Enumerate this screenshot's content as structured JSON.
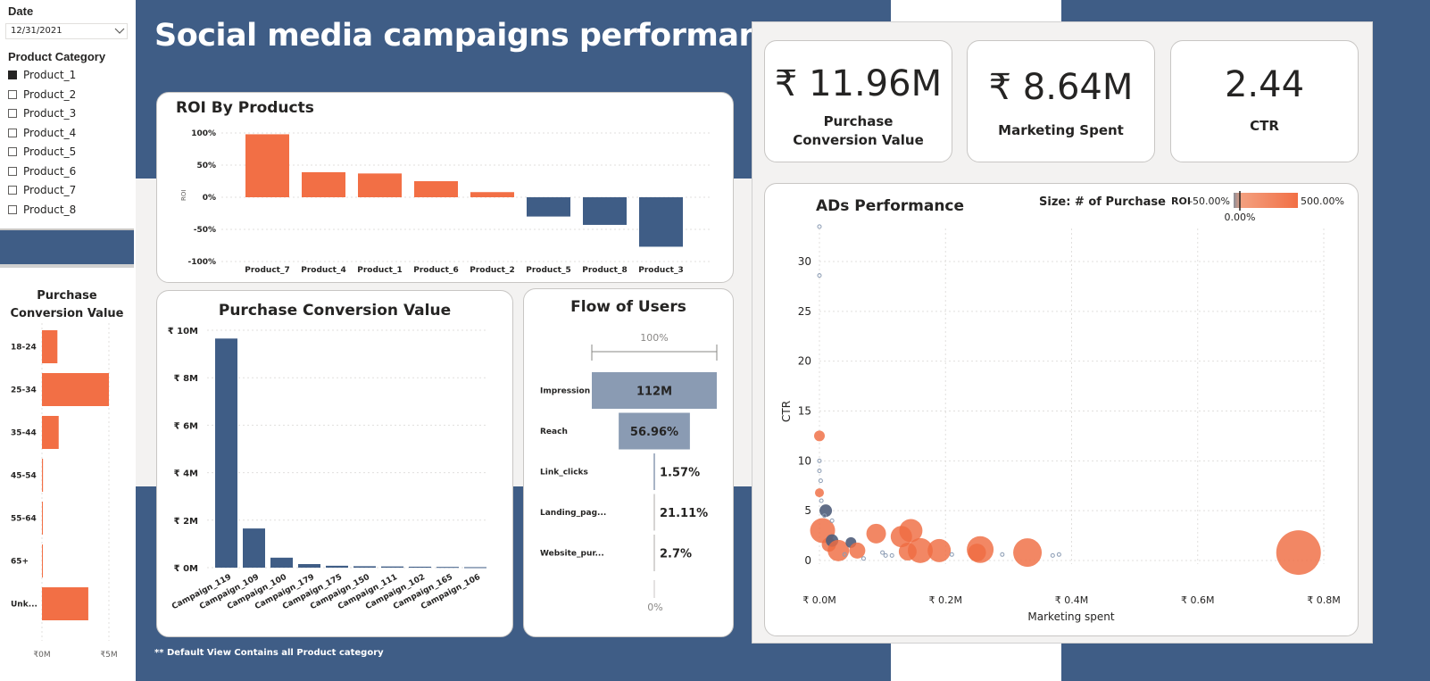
{
  "filters": {
    "date_label": "Date",
    "date_value": "12/31/2021",
    "category_label": "Product Category",
    "products": [
      {
        "label": "Product_1",
        "checked": true
      },
      {
        "label": "Product_2",
        "checked": false
      },
      {
        "label": "Product_3",
        "checked": false
      },
      {
        "label": "Product_4",
        "checked": false
      },
      {
        "label": "Product_5",
        "checked": false
      },
      {
        "label": "Product_6",
        "checked": false
      },
      {
        "label": "Product_7",
        "checked": false
      },
      {
        "label": "Product_8",
        "checked": false
      }
    ]
  },
  "title": "Social media campaigns performance",
  "footnote": "** Default View Contains all Product category",
  "kpis": [
    {
      "value": "₹ 11.96M",
      "label": "Purchase Conversion Value"
    },
    {
      "value": "₹ 8.64M",
      "label": "Marketing Spent"
    },
    {
      "value": "2.44",
      "label": "CTR"
    }
  ],
  "colors": {
    "navy": "#3f5d86",
    "orange": "#f26f45",
    "funnel": "#8a9bb3",
    "background_light": "#f3f2f1"
  },
  "chart_data": [
    {
      "type": "bar",
      "title": "Purchase Conversion Value",
      "orientation": "horizontal",
      "categories": [
        "18-24",
        "25-34",
        "35-44",
        "45-54",
        "55-64",
        "65+",
        "Unk..."
      ],
      "values": [
        1.2,
        5.2,
        1.3,
        0.08,
        0.05,
        0.05,
        3.6
      ],
      "value_unit": "₹ M",
      "xticks": [
        "₹0M",
        "₹5M"
      ],
      "xlim": [
        0,
        5.2
      ]
    },
    {
      "type": "bar",
      "title": "ROI By Products",
      "ylabel": "ROI",
      "categories": [
        "Product_7",
        "Product_4",
        "Product_1",
        "Product_6",
        "Product_2",
        "Product_5",
        "Product_8",
        "Product_3"
      ],
      "values": [
        98,
        39,
        37,
        25,
        8,
        -30,
        -43,
        -77
      ],
      "value_unit": "%",
      "yticks": [
        "100%",
        "50%",
        "0%",
        "-50%",
        "-100%"
      ],
      "ylim": [
        -100,
        100
      ]
    },
    {
      "type": "bar",
      "title": "Purchase Conversion Value",
      "categories": [
        "Campaign_119",
        "Campaign_109",
        "Campaign_100",
        "Campaign_179",
        "Campaign_175",
        "Campaign_150",
        "Campaign_111",
        "Campaign_102",
        "Campaign_165",
        "Campaign_106"
      ],
      "values": [
        9.65,
        1.65,
        0.42,
        0.15,
        0.08,
        0.06,
        0.05,
        0.04,
        0.03,
        0.02
      ],
      "value_unit": "₹ M",
      "yticks": [
        "₹ 10M",
        "₹ 8M",
        "₹ 6M",
        "₹ 4M",
        "₹ 2M",
        "₹ 0M"
      ],
      "ylim": [
        0,
        10
      ]
    },
    {
      "type": "funnel",
      "title": "Flow of Users",
      "top_label": "100%",
      "bottom_label": "0%",
      "stages": [
        {
          "label": "Impression",
          "value_label": "112M",
          "fraction": 1.0
        },
        {
          "label": "Reach",
          "value_label": "56.96%",
          "fraction": 0.5696
        },
        {
          "label": "Link_clicks",
          "value_label": "1.57%",
          "fraction": 0.0157
        },
        {
          "label": "Landing_pag...",
          "value_label": "21.11%",
          "fraction": 0.0
        },
        {
          "label": "Website_pur...",
          "value_label": "2.7%",
          "fraction": 0.0
        }
      ]
    },
    {
      "type": "scatter",
      "title": "ADs Performance",
      "size_legend": "Size: # of Purchase",
      "color_legend": {
        "label": "ROI",
        "min_label": "-50.00%",
        "mid_label": "0.00%",
        "max_label": "500.00%"
      },
      "xlabel": "Marketing spent",
      "ylabel": "CTR",
      "xticks": [
        "₹ 0.0M",
        "₹ 0.2M",
        "₹ 0.4M",
        "₹ 0.6M",
        "₹ 0.8M"
      ],
      "yticks": [
        "30",
        "25",
        "20",
        "15",
        "10",
        "5",
        "0"
      ],
      "xlim": [
        0,
        0.8
      ],
      "ylim": [
        0,
        30
      ],
      "points": [
        {
          "x": 0.0,
          "y": 12.5,
          "r": 6,
          "kind": "orange"
        },
        {
          "x": 0.0,
          "y": 6.8,
          "r": 5,
          "kind": "orange"
        },
        {
          "x": 0.01,
          "y": 5.0,
          "r": 7,
          "kind": "dark"
        },
        {
          "x": 0.005,
          "y": 3.0,
          "r": 14,
          "kind": "orange"
        },
        {
          "x": 0.015,
          "y": 1.6,
          "r": 8,
          "kind": "orange"
        },
        {
          "x": 0.02,
          "y": 2.0,
          "r": 7,
          "kind": "dark"
        },
        {
          "x": 0.03,
          "y": 1.0,
          "r": 12,
          "kind": "orange"
        },
        {
          "x": 0.05,
          "y": 1.8,
          "r": 6,
          "kind": "dark"
        },
        {
          "x": 0.06,
          "y": 1.0,
          "r": 9,
          "kind": "orange"
        },
        {
          "x": 0.09,
          "y": 2.7,
          "r": 11,
          "kind": "orange"
        },
        {
          "x": 0.13,
          "y": 2.4,
          "r": 12,
          "kind": "orange"
        },
        {
          "x": 0.145,
          "y": 3.0,
          "r": 13,
          "kind": "orange"
        },
        {
          "x": 0.14,
          "y": 0.9,
          "r": 10,
          "kind": "orange"
        },
        {
          "x": 0.16,
          "y": 1.0,
          "r": 14,
          "kind": "orange"
        },
        {
          "x": 0.19,
          "y": 1.0,
          "r": 13,
          "kind": "orange"
        },
        {
          "x": 0.255,
          "y": 1.1,
          "r": 15,
          "kind": "orange"
        },
        {
          "x": 0.25,
          "y": 0.8,
          "r": 10,
          "kind": "orange"
        },
        {
          "x": 0.33,
          "y": 0.8,
          "r": 16,
          "kind": "orange"
        },
        {
          "x": 0.76,
          "y": 0.8,
          "r": 25,
          "kind": "orange"
        },
        {
          "x": 0.0,
          "y": 33.5,
          "r": 2,
          "kind": "hollow"
        },
        {
          "x": 0.0,
          "y": 28.6,
          "r": 2,
          "kind": "hollow"
        },
        {
          "x": 0.0,
          "y": 10.0,
          "r": 2,
          "kind": "hollow"
        },
        {
          "x": 0.0,
          "y": 9.0,
          "r": 2,
          "kind": "hollow"
        },
        {
          "x": 0.002,
          "y": 8.0,
          "r": 2,
          "kind": "hollow"
        },
        {
          "x": 0.003,
          "y": 6.0,
          "r": 2,
          "kind": "hollow"
        },
        {
          "x": 0.008,
          "y": 4.5,
          "r": 2,
          "kind": "hollow"
        },
        {
          "x": 0.02,
          "y": 4.0,
          "r": 2,
          "kind": "hollow"
        },
        {
          "x": 0.04,
          "y": 0.6,
          "r": 2,
          "kind": "hollow"
        },
        {
          "x": 0.07,
          "y": 0.2,
          "r": 2,
          "kind": "hollow"
        },
        {
          "x": 0.1,
          "y": 0.8,
          "r": 2,
          "kind": "hollow"
        },
        {
          "x": 0.105,
          "y": 0.5,
          "r": 2,
          "kind": "hollow"
        },
        {
          "x": 0.115,
          "y": 0.5,
          "r": 2,
          "kind": "hollow"
        },
        {
          "x": 0.21,
          "y": 0.6,
          "r": 2,
          "kind": "hollow"
        },
        {
          "x": 0.29,
          "y": 0.6,
          "r": 2,
          "kind": "hollow"
        },
        {
          "x": 0.37,
          "y": 0.5,
          "r": 2,
          "kind": "hollow"
        },
        {
          "x": 0.38,
          "y": 0.6,
          "r": 2,
          "kind": "hollow"
        }
      ]
    }
  ]
}
